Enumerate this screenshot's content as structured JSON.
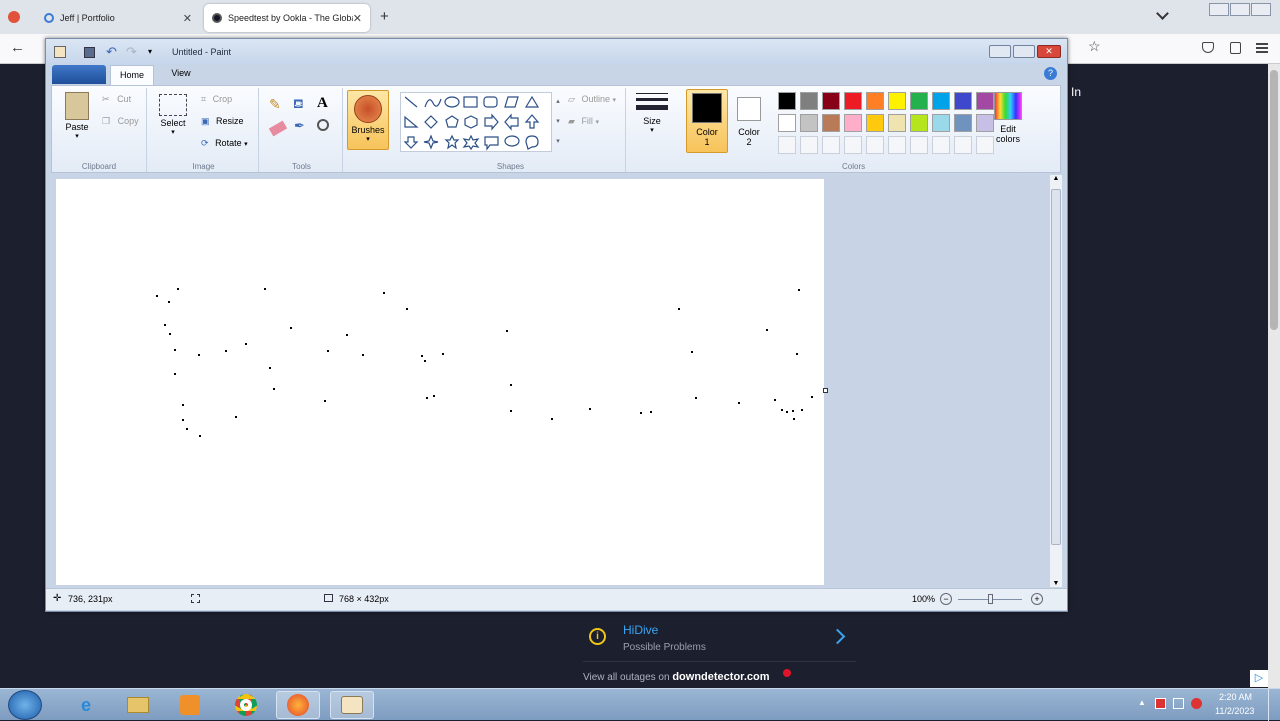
{
  "browser": {
    "tabs": [
      {
        "title": "Jeff | Portfolio"
      },
      {
        "title": "Speedtest by Ookla - The Globa"
      }
    ],
    "new_tab": "+",
    "menu_chevron": "⌄",
    "page_partial_text": "In"
  },
  "paint": {
    "title": "Untitled - Paint",
    "tabs": {
      "home": "Home",
      "view": "View"
    },
    "clipboard": {
      "paste": "Paste",
      "cut": "Cut",
      "copy": "Copy",
      "label": "Clipboard"
    },
    "image": {
      "select": "Select",
      "crop": "Crop",
      "resize": "Resize",
      "rotate": "Rotate",
      "label": "Image"
    },
    "tools": {
      "label": "Tools"
    },
    "brushes": "Brushes",
    "shapes": {
      "label": "Shapes",
      "outline": "Outline",
      "fill": "Fill"
    },
    "size": "Size",
    "color1": {
      "label": "Color",
      "num": "1",
      "value": "#000000"
    },
    "color2": {
      "label": "Color",
      "num": "2",
      "value": "#ffffff"
    },
    "colors_label": "Colors",
    "edit_colors": {
      "line1": "Edit",
      "line2": "colors"
    },
    "palette_row1": [
      "#000000",
      "#7f7f7f",
      "#880015",
      "#ed1c24",
      "#ff7f27",
      "#fff200",
      "#22b14c",
      "#00a2e8",
      "#3f48cc",
      "#a349a4"
    ],
    "palette_row2": [
      "#ffffff",
      "#c3c3c3",
      "#b97a57",
      "#ffaec9",
      "#ffc90e",
      "#efe4b0",
      "#b5e61d",
      "#99d9ea",
      "#7092be",
      "#c8bfe7"
    ],
    "status": {
      "cursor": "736, 231px",
      "size": "768 × 432px",
      "zoom": "100%"
    }
  },
  "downdetector": {
    "service": "HiDive",
    "status": "Possible Problems",
    "footer_prefix": "View all outages on",
    "footer_brand": "downdetector.com"
  },
  "taskbar": {
    "time": "2:20 AM",
    "date": "11/2/2023"
  }
}
